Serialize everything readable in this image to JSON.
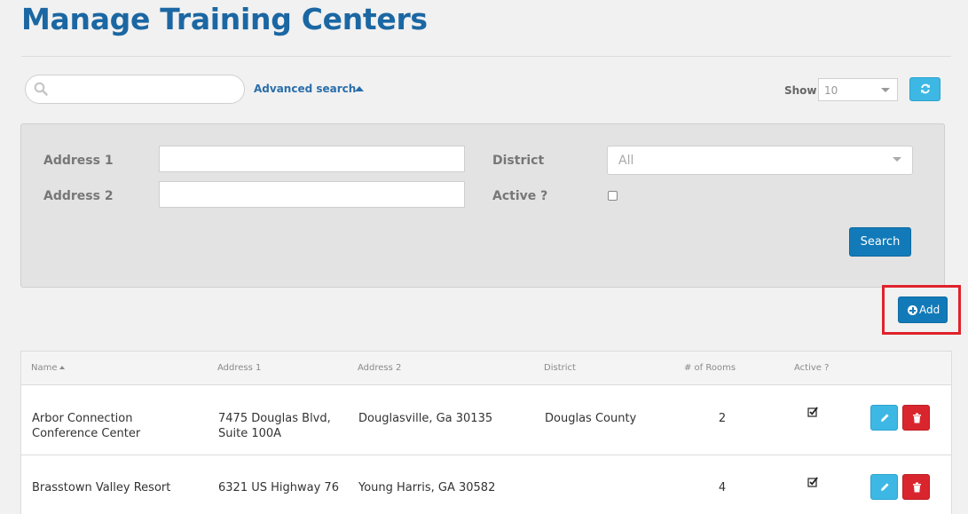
{
  "page": {
    "title": "Manage Training Centers"
  },
  "toolbar": {
    "search_placeholder": "",
    "advanced_search_label": "Advanced search",
    "show_label": "Show",
    "show_value": "10"
  },
  "advanced_search": {
    "address1_label": "Address 1",
    "address2_label": "Address 2",
    "district_label": "District",
    "district_value": "All",
    "active_label": "Active ?",
    "active_checked": false,
    "search_button": "Search"
  },
  "add_button": "Add",
  "table": {
    "columns": [
      "Name",
      "Address 1",
      "Address 2",
      "District",
      "# of Rooms",
      "Active ?"
    ],
    "rows": [
      {
        "name": "Arbor Connection Conference Center",
        "address1": "7475 Douglas Blvd, Suite 100A",
        "address2": "Douglasville, Ga 30135",
        "district": "Douglas County",
        "rooms": "2",
        "active": true
      },
      {
        "name": "Brasstown Valley Resort",
        "address1": "6321 US Highway 76",
        "address2": "Young Harris, GA 30582",
        "district": "",
        "rooms": "4",
        "active": true
      }
    ]
  },
  "colors": {
    "primary": "#127ab8",
    "title": "#1b67a3",
    "info": "#3db8e4",
    "danger": "#d9262e",
    "highlight": "#e0222c"
  }
}
